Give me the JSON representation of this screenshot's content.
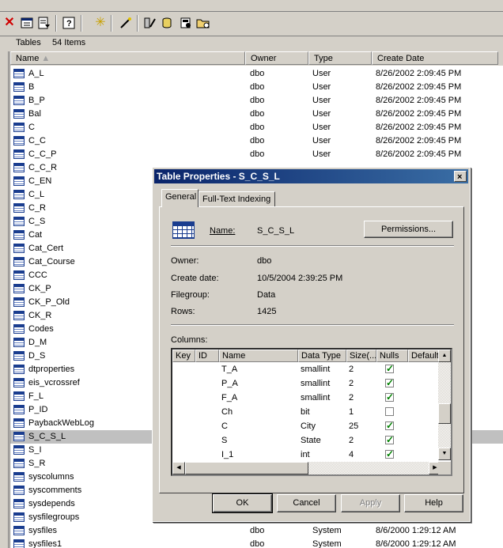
{
  "header": {
    "object_type": "Tables",
    "item_count": "54 Items"
  },
  "toolbar": {
    "icons": [
      "delete-icon",
      "properties-icon",
      "export-list-icon",
      "help-icon",
      "new-icon",
      "wizard-icon",
      "query-icon",
      "database-icon",
      "server-icon",
      "folder-icon"
    ]
  },
  "columns": {
    "name": "Name",
    "owner": "Owner",
    "type": "Type",
    "create_date": "Create Date"
  },
  "tables": [
    {
      "name": "A_L",
      "owner": "dbo",
      "type": "User",
      "date": "8/26/2002 2:09:45 PM"
    },
    {
      "name": "B",
      "owner": "dbo",
      "type": "User",
      "date": "8/26/2002 2:09:45 PM"
    },
    {
      "name": "B_P",
      "owner": "dbo",
      "type": "User",
      "date": "8/26/2002 2:09:45 PM"
    },
    {
      "name": "Bal",
      "owner": "dbo",
      "type": "User",
      "date": "8/26/2002 2:09:45 PM"
    },
    {
      "name": "C",
      "owner": "dbo",
      "type": "User",
      "date": "8/26/2002 2:09:45 PM"
    },
    {
      "name": "C_C",
      "owner": "dbo",
      "type": "User",
      "date": "8/26/2002 2:09:45 PM"
    },
    {
      "name": "C_C_P",
      "owner": "dbo",
      "type": "User",
      "date": "8/26/2002 2:09:45 PM"
    },
    {
      "name": "C_C_R",
      "owner": "",
      "type": "",
      "date": ""
    },
    {
      "name": "C_EN",
      "owner": "",
      "type": "",
      "date": ""
    },
    {
      "name": "C_L",
      "owner": "",
      "type": "",
      "date": ""
    },
    {
      "name": "C_R",
      "owner": "",
      "type": "",
      "date": ""
    },
    {
      "name": "C_S",
      "owner": "",
      "type": "",
      "date": ""
    },
    {
      "name": "Cat",
      "owner": "",
      "type": "",
      "date": ""
    },
    {
      "name": "Cat_Cert",
      "owner": "",
      "type": "",
      "date": ""
    },
    {
      "name": "Cat_Course",
      "owner": "",
      "type": "",
      "date": ""
    },
    {
      "name": "CCC",
      "owner": "",
      "type": "",
      "date": ""
    },
    {
      "name": "CK_P",
      "owner": "",
      "type": "",
      "date": ""
    },
    {
      "name": "CK_P_Old",
      "owner": "",
      "type": "",
      "date": ""
    },
    {
      "name": "CK_R",
      "owner": "",
      "type": "",
      "date": ""
    },
    {
      "name": "Codes",
      "owner": "",
      "type": "",
      "date": ""
    },
    {
      "name": "D_M",
      "owner": "",
      "type": "",
      "date": ""
    },
    {
      "name": "D_S",
      "owner": "",
      "type": "",
      "date": ""
    },
    {
      "name": "dtproperties",
      "owner": "",
      "type": "",
      "date": ""
    },
    {
      "name": "eis_vcrossref",
      "owner": "",
      "type": "",
      "date": ""
    },
    {
      "name": "F_L",
      "owner": "",
      "type": "",
      "date": ""
    },
    {
      "name": "P_ID",
      "owner": "",
      "type": "",
      "date": ""
    },
    {
      "name": "PaybackWebLog",
      "owner": "",
      "type": "",
      "date": ""
    },
    {
      "name": "S_C_S_L",
      "owner": "",
      "type": "",
      "date": "",
      "selected": true
    },
    {
      "name": "S_I",
      "owner": "",
      "type": "",
      "date": ""
    },
    {
      "name": "S_R",
      "owner": "",
      "type": "",
      "date": ""
    },
    {
      "name": "syscolumns",
      "owner": "",
      "type": "",
      "date": ""
    },
    {
      "name": "syscomments",
      "owner": "",
      "type": "",
      "date": ""
    },
    {
      "name": "sysdepends",
      "owner": "",
      "type": "",
      "date": ""
    },
    {
      "name": "sysfilegroups",
      "owner": "",
      "type": "",
      "date": ""
    },
    {
      "name": "sysfiles",
      "owner": "dbo",
      "type": "System",
      "date": "8/6/2000 1:29:12 AM"
    },
    {
      "name": "sysfiles1",
      "owner": "dbo",
      "type": "System",
      "date": "8/6/2000 1:29:12 AM"
    }
  ],
  "dialog": {
    "title": "Table Properties - S_C_S_L",
    "close_label": "×",
    "tabs": [
      "General",
      "Full-Text Indexing"
    ],
    "name_label": "Name:",
    "name_value": "S_C_S_L",
    "permissions_label": "Permissions...",
    "owner_label": "Owner:",
    "owner_value": "dbo",
    "create_date_label": "Create date:",
    "create_date_value": "10/5/2004 2:39:25 PM",
    "filegroup_label": "Filegroup:",
    "filegroup_value": "Data",
    "rows_label": "Rows:",
    "rows_value": "1425",
    "columns_label": "Columns:",
    "grid_headers": [
      "Key",
      "ID",
      "Name",
      "Data Type",
      "Size(...",
      "Nulls",
      "Default"
    ],
    "grid_rows": [
      {
        "name": "T_A",
        "type": "smallint",
        "size": "2",
        "nulls": true
      },
      {
        "name": "P_A",
        "type": "smallint",
        "size": "2",
        "nulls": true
      },
      {
        "name": "F_A",
        "type": "smallint",
        "size": "2",
        "nulls": true
      },
      {
        "name": "Ch",
        "type": "bit",
        "size": "1",
        "nulls": false
      },
      {
        "name": "C",
        "type": "City",
        "size": "25",
        "nulls": true
      },
      {
        "name": "S",
        "type": "State",
        "size": "2",
        "nulls": true
      },
      {
        "name": "I_1",
        "type": "int",
        "size": "4",
        "nulls": true
      }
    ],
    "buttons": {
      "ok": "OK",
      "cancel": "Cancel",
      "apply": "Apply",
      "help": "Help"
    }
  }
}
